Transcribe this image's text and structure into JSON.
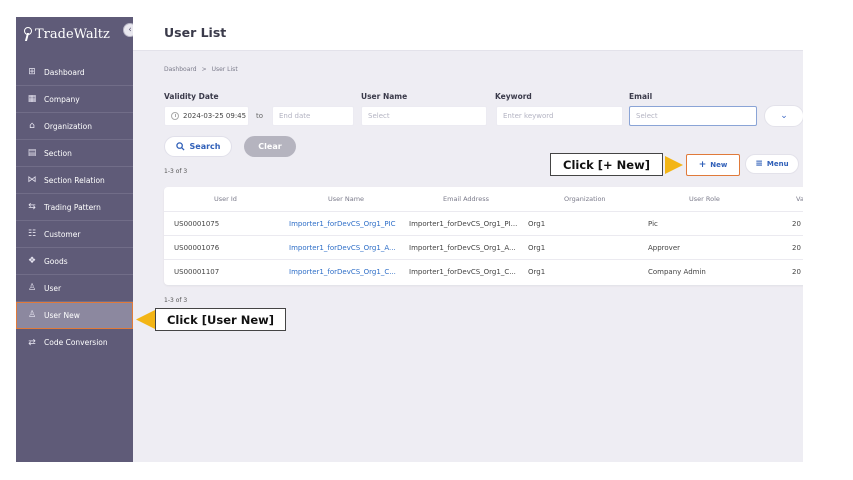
{
  "app": {
    "name": "TradeWaltz"
  },
  "sidebar": {
    "items": [
      {
        "label": "Dashboard",
        "icon": "dashboard-icon"
      },
      {
        "label": "Company",
        "icon": "company-icon"
      },
      {
        "label": "Organization",
        "icon": "organization-icon"
      },
      {
        "label": "Section",
        "icon": "section-icon"
      },
      {
        "label": "Section Relation",
        "icon": "section-relation-icon"
      },
      {
        "label": "Trading Pattern",
        "icon": "trading-pattern-icon"
      },
      {
        "label": "Customer",
        "icon": "customer-icon"
      },
      {
        "label": "Goods",
        "icon": "goods-icon"
      },
      {
        "label": "User",
        "icon": "user-icon"
      },
      {
        "label": "User New",
        "icon": "user-new-icon",
        "active": true
      },
      {
        "label": "Code Conversion",
        "icon": "code-conversion-icon"
      }
    ]
  },
  "header": {
    "title": "User List"
  },
  "breadcrumb": {
    "root": "Dashboard",
    "separator": ">",
    "current": "User List"
  },
  "filters": {
    "validity_label": "Validity Date",
    "validity_from": "2024-03-25 09:45",
    "to_label": "to",
    "validity_to_placeholder": "End date",
    "user_name_label": "User Name",
    "user_name_placeholder": "Select",
    "keyword_label": "Keyword",
    "keyword_placeholder": "Enter keyword",
    "email_label": "Email",
    "email_placeholder": "Select"
  },
  "actions": {
    "search_label": "Search",
    "clear_label": "Clear",
    "new_label": "New",
    "menu_label": "Menu"
  },
  "results": {
    "count_top": "1-3 of 3",
    "count_bottom": "1-3 of 3"
  },
  "table": {
    "columns": [
      "User Id",
      "User Name",
      "Email Address",
      "Organization",
      "User Role",
      "Va"
    ],
    "rows": [
      [
        "US00001075",
        "Importer1_forDevCS_Org1_PIC",
        "Importer1_forDevCS_Org1_PI...",
        "Org1",
        "Pic",
        "20"
      ],
      [
        "US00001076",
        "Importer1_forDevCS_Org1_A...",
        "Importer1_forDevCS_Org1_A...",
        "Org1",
        "Approver",
        "20"
      ],
      [
        "US00001107",
        "Importer1_forDevCS_Org1_C...",
        "Importer1_forDevCS_Org1_C...",
        "Org1",
        "Company Admin",
        "20"
      ]
    ]
  },
  "annotations": {
    "new_callout": "Click [+ New]",
    "user_new_callout": "Click [User New]"
  },
  "colors": {
    "sidebar": "#5f5b78",
    "accent": "#2f5fb8",
    "highlight_border": "#e07a3a",
    "arrow": "#f3b515"
  }
}
